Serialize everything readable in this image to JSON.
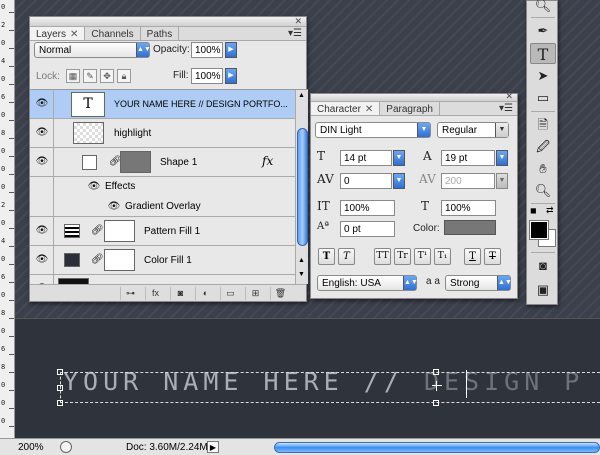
{
  "ruler": {
    "labels": [
      "0",
      "2",
      "0",
      "4",
      "0",
      "6",
      "0",
      "8",
      "0",
      "0",
      "0",
      "2",
      "0",
      "4",
      "0",
      "6",
      "0",
      "8",
      "0",
      "6",
      "8",
      "0",
      "0",
      "0"
    ]
  },
  "canvas": {
    "text_main": "YOUR NAME HERE //",
    "text_dim": "DESIGN P"
  },
  "status": {
    "zoom": "200%",
    "doc": "Doc: 3.60M/2.24M"
  },
  "layers_panel": {
    "tabs": [
      {
        "label": "Layers"
      },
      {
        "label": "Channels"
      },
      {
        "label": "Paths"
      }
    ],
    "blend_mode": "Normal",
    "opacity_label": "Opacity:",
    "opacity_value": "100%",
    "lock_label": "Lock:",
    "fill_label": "Fill:",
    "fill_value": "100%",
    "layers": [
      {
        "name": "YOUR NAME HERE  //  DESIGN PORTFO...",
        "thumb_text": "T"
      },
      {
        "name": "highlight"
      },
      {
        "name": "Shape 1",
        "fx": "fx"
      },
      {
        "name": "Effects"
      },
      {
        "name": "Gradient Overlay"
      },
      {
        "name": "Pattern Fill 1"
      },
      {
        "name": "Color Fill 1"
      }
    ]
  },
  "character_panel": {
    "tabs": [
      {
        "label": "Character"
      },
      {
        "label": "Paragraph"
      }
    ],
    "font_family": "DIN Light",
    "font_style": "Regular",
    "font_size": "14 pt",
    "leading": "19 pt",
    "kerning": "0",
    "tracking": "200",
    "vscale": "100%",
    "hscale": "100%",
    "baseline": "0 pt",
    "color_label": "Color:",
    "style_buttons": [
      "T",
      "T",
      "TT",
      "Tr",
      "T¹",
      "T₁",
      "T",
      "T"
    ],
    "language": "English: USA",
    "aa_label": "a a",
    "antialias": "Strong"
  }
}
